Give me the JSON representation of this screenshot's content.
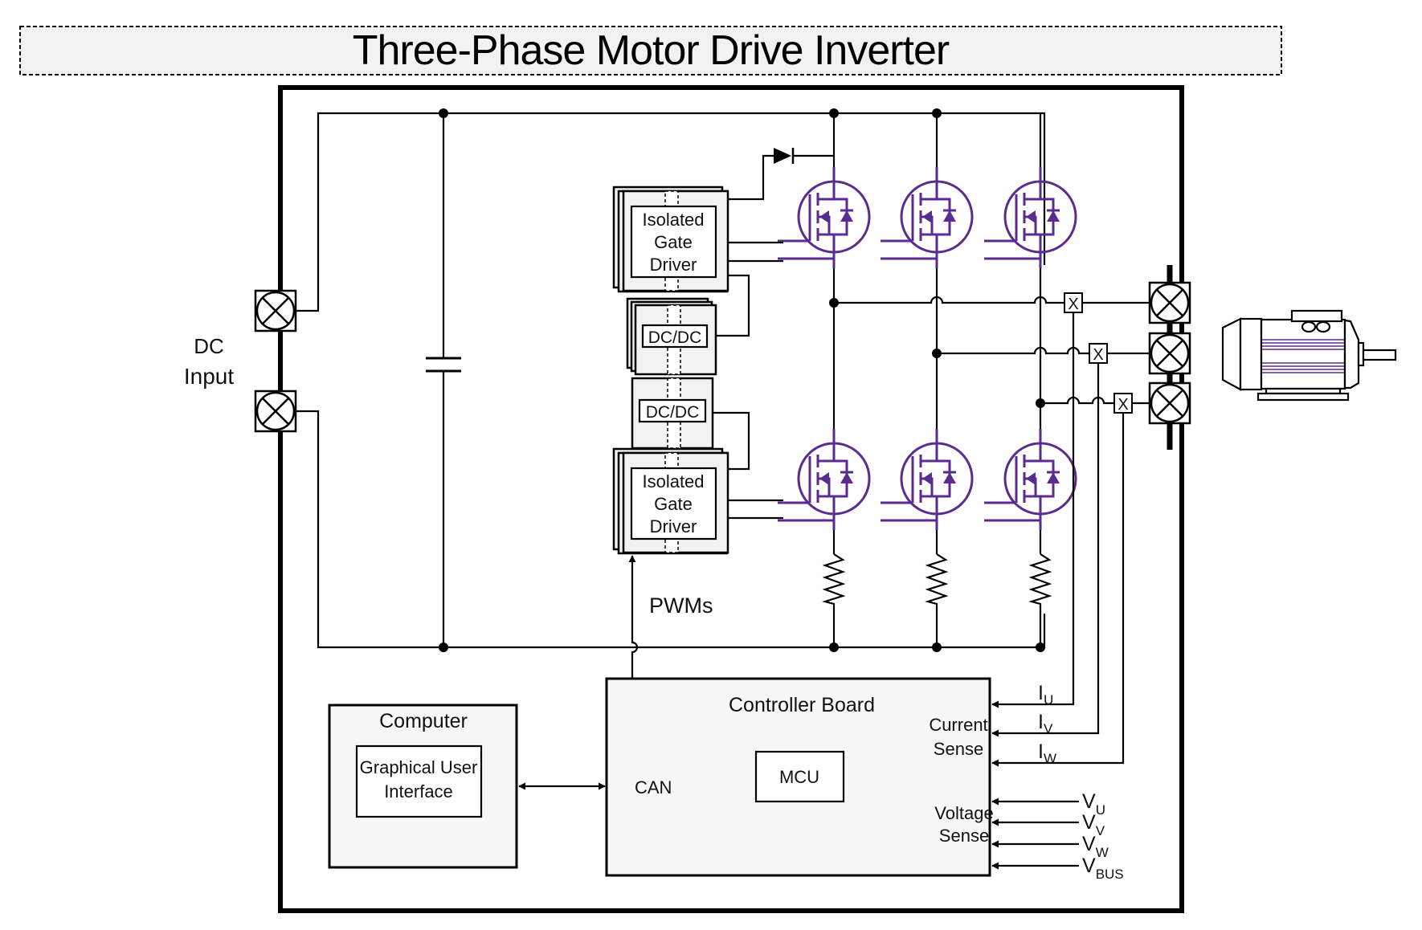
{
  "title": "Three-Phase Motor Drive Inverter",
  "colors": {
    "mosfet": "#5b2c8f",
    "wire": "#000000",
    "block_fill": "#f2f2f2",
    "title_fill": "#f2f2f2"
  },
  "dc_input": {
    "line1": "DC",
    "line2": "Input"
  },
  "gate_driver_high": {
    "line1": "Isolated",
    "line2": "Gate",
    "line3": "Driver"
  },
  "gate_driver_low": {
    "line1": "Isolated",
    "line2": "Gate",
    "line3": "Driver"
  },
  "dcdc_high": "DC/DC",
  "dcdc_low": "DC/DC",
  "pwms_label": "PWMs",
  "phases": [
    "U",
    "V",
    "W"
  ],
  "sensor_mark": "X",
  "controller": {
    "title": "Controller Board",
    "can_label": "CAN",
    "mcu_label": "MCU",
    "current_sense": {
      "line1": "Current",
      "line2": "Sense"
    },
    "voltage_sense": {
      "line1": "Voltage",
      "line2": "Sense"
    },
    "current_inputs": [
      {
        "base": "I",
        "sub": "U"
      },
      {
        "base": "I",
        "sub": "V"
      },
      {
        "base": "I",
        "sub": "W"
      }
    ],
    "voltage_inputs": [
      {
        "base": "V",
        "sub": "U"
      },
      {
        "base": "V",
        "sub": "V"
      },
      {
        "base": "V",
        "sub": "W"
      },
      {
        "base": "V",
        "sub": "BUS"
      }
    ]
  },
  "computer": {
    "title": "Computer",
    "gui": {
      "line1": "Graphical User",
      "line2": "Interface"
    }
  },
  "icons": [
    "connector-x-icon",
    "mosfet-icon",
    "diode-icon",
    "capacitor-icon",
    "resistor-icon",
    "motor-icon",
    "current-sensor-icon"
  ]
}
